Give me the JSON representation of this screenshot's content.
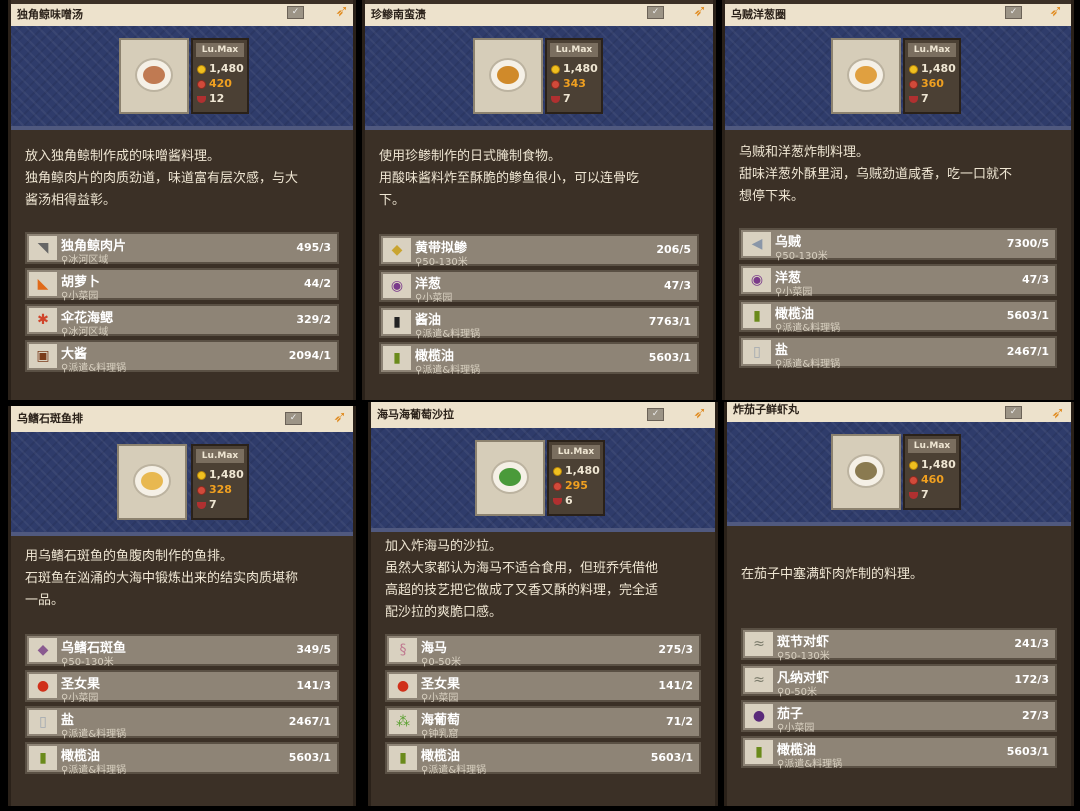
{
  "cards": [
    {
      "title": "独角鲸味噌汤",
      "level": "Lu.Max",
      "price": "1,480",
      "taste": "420",
      "bowls": "12",
      "desc": [
        "放入独角鲸制作成的味噌酱料理。",
        "独角鲸肉片的肉质劲道，味道富有层次感，与大",
        "酱汤相得益彰。"
      ],
      "ingredients": [
        {
          "name": "独角鲸肉片",
          "loc": "冰河区域",
          "count": "495/3",
          "icon": "fish-meat-icon"
        },
        {
          "name": "胡萝卜",
          "loc": "小菜园",
          "count": "44/2",
          "icon": "carrot-icon"
        },
        {
          "name": "伞花海鳃",
          "loc": "冰河区域",
          "count": "329/2",
          "icon": "coral-icon"
        },
        {
          "name": "大酱",
          "loc": "派遣&料理锅",
          "count": "2094/1",
          "icon": "jar-icon"
        }
      ]
    },
    {
      "title": "珍鲹南蛮渍",
      "level": "Lu.Max",
      "price": "1,480",
      "taste": "343",
      "bowls": "7",
      "desc": [
        "使用珍鲹制作的日式腌制食物。",
        "用酸味酱料炸至酥脆的鲹鱼很小，可以连骨吃",
        "下。"
      ],
      "ingredients": [
        {
          "name": "黄带拟鲹",
          "loc": "50-130米",
          "count": "206/5",
          "icon": "fish-icon"
        },
        {
          "name": "洋葱",
          "loc": "小菜园",
          "count": "47/3",
          "icon": "onion-icon"
        },
        {
          "name": "酱油",
          "loc": "派遣&料理锅",
          "count": "7763/1",
          "icon": "soy-sauce-icon"
        },
        {
          "name": "橄榄油",
          "loc": "派遣&料理锅",
          "count": "5603/1",
          "icon": "olive-oil-icon"
        }
      ]
    },
    {
      "title": "乌贼洋葱圈",
      "level": "Lu.Max",
      "price": "1,480",
      "taste": "360",
      "bowls": "7",
      "desc": [
        "乌贼和洋葱炸制料理。",
        "甜味洋葱外酥里润，乌贼劲道咸香，吃一口就不",
        "想停下来。"
      ],
      "ingredients": [
        {
          "name": "乌贼",
          "loc": "50-130米",
          "count": "7300/5",
          "icon": "squid-icon"
        },
        {
          "name": "洋葱",
          "loc": "小菜园",
          "count": "47/3",
          "icon": "onion-icon"
        },
        {
          "name": "橄榄油",
          "loc": "派遣&料理锅",
          "count": "5603/1",
          "icon": "olive-oil-icon"
        },
        {
          "name": "盐",
          "loc": "派遣&料理锅",
          "count": "2467/1",
          "icon": "salt-icon"
        }
      ]
    },
    {
      "title": "乌鳍石斑鱼排",
      "level": "Lu.Max",
      "price": "1,480",
      "taste": "328",
      "bowls": "7",
      "desc": [
        "用乌鳍石斑鱼的鱼腹肉制作的鱼排。",
        "石斑鱼在汹涌的大海中锻炼出来的结实肉质堪称",
        "一品。"
      ],
      "ingredients": [
        {
          "name": "乌鳍石斑鱼",
          "loc": "50-130米",
          "count": "349/5",
          "icon": "grouper-icon"
        },
        {
          "name": "圣女果",
          "loc": "小菜园",
          "count": "141/3",
          "icon": "tomato-icon"
        },
        {
          "name": "盐",
          "loc": "派遣&料理锅",
          "count": "2467/1",
          "icon": "salt-icon"
        },
        {
          "name": "橄榄油",
          "loc": "派遣&料理锅",
          "count": "5603/1",
          "icon": "olive-oil-icon"
        }
      ]
    },
    {
      "title": "海马海葡萄沙拉",
      "level": "Lu.Max",
      "price": "1,480",
      "taste": "295",
      "bowls": "6",
      "desc": [
        "加入炸海马的沙拉。",
        "虽然大家都认为海马不适合食用，但班乔凭借他",
        "高超的技艺把它做成了又香又酥的料理，完全适",
        "配沙拉的爽脆口感。"
      ],
      "ingredients": [
        {
          "name": "海马",
          "loc": "0-50米",
          "count": "275/3",
          "icon": "seahorse-icon"
        },
        {
          "name": "圣女果",
          "loc": "小菜园",
          "count": "141/2",
          "icon": "tomato-icon"
        },
        {
          "name": "海葡萄",
          "loc": "钟乳窟",
          "count": "71/2",
          "icon": "sea-grape-icon"
        },
        {
          "name": "橄榄油",
          "loc": "派遣&料理锅",
          "count": "5603/1",
          "icon": "olive-oil-icon"
        }
      ]
    },
    {
      "title": "炸茄子鲜虾丸",
      "level": "Lu.Max",
      "price": "1,480",
      "taste": "460",
      "bowls": "7",
      "desc": [
        "在茄子中塞满虾肉炸制的料理。"
      ],
      "ingredients": [
        {
          "name": "斑节对虾",
          "loc": "50-130米",
          "count": "241/3",
          "icon": "shrimp-icon"
        },
        {
          "name": "凡纳对虾",
          "loc": "0-50米",
          "count": "172/3",
          "icon": "shrimp-icon"
        },
        {
          "name": "茄子",
          "loc": "小菜园",
          "count": "27/3",
          "icon": "eggplant-icon"
        },
        {
          "name": "橄榄油",
          "loc": "派遣&料理锅",
          "count": "5603/1",
          "icon": "olive-oil-icon"
        }
      ]
    }
  ]
}
